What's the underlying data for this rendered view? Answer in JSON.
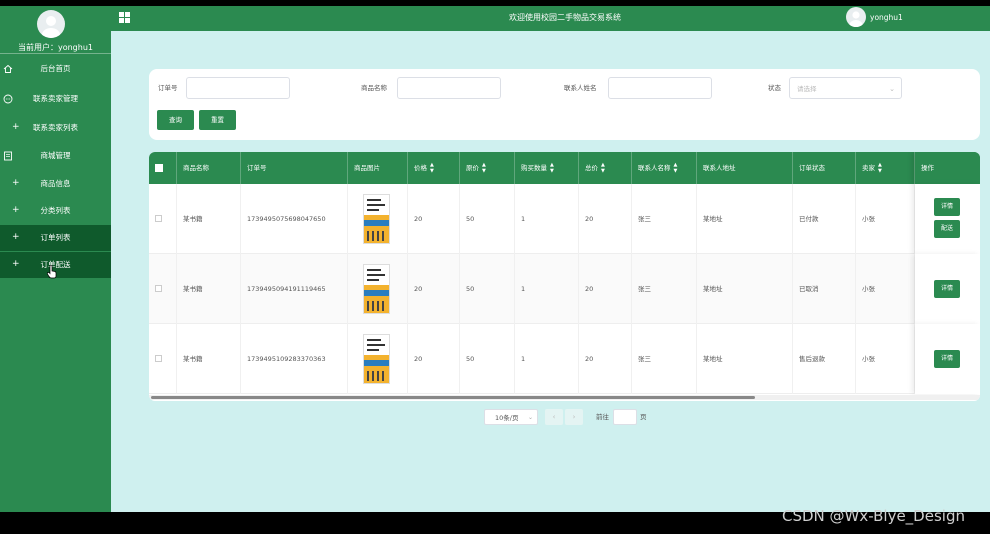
{
  "header": {
    "title": "欢迎使用校园二手物品交易系统",
    "username": "yonghu1"
  },
  "sidebar": {
    "current_user_label": "当前用户：",
    "current_user": "yonghu1",
    "items": [
      {
        "label": "后台首页",
        "icon": "home-icon"
      },
      {
        "label": "联系卖家管理",
        "icon": "chat-icon"
      },
      {
        "label": "联系卖家列表",
        "icon": "plus-icon"
      },
      {
        "label": "商城管理",
        "icon": "document-icon"
      },
      {
        "label": "商品信息",
        "icon": "plus-icon"
      },
      {
        "label": "分类列表",
        "icon": "plus-icon"
      },
      {
        "label": "订单列表",
        "icon": "plus-icon"
      },
      {
        "label": "订单配送",
        "icon": "plus-icon"
      }
    ]
  },
  "search": {
    "order_no_label": "订单号",
    "product_name_label": "商品名称",
    "contact_name_label": "联系人姓名",
    "status_label": "状态",
    "status_placeholder": "请选择",
    "query_button": "查询",
    "reset_button": "重置"
  },
  "table": {
    "columns": [
      "商品名称",
      "订单号",
      "商品图片",
      "价格",
      "原价",
      "购买数量",
      "总价",
      "联系人名称",
      "联系人地址",
      "订单状态",
      "卖家",
      "操作"
    ],
    "rows": [
      {
        "name": "某书籍",
        "order_no": "1739495075698047650",
        "price": "20",
        "original_price": "50",
        "qty": "1",
        "total": "20",
        "contact": "张三",
        "address": "某地址",
        "status": "已付款",
        "seller": "小张",
        "actions": [
          "详情",
          "配送"
        ]
      },
      {
        "name": "某书籍",
        "order_no": "1739495094191119465",
        "price": "20",
        "original_price": "50",
        "qty": "1",
        "total": "20",
        "contact": "张三",
        "address": "某地址",
        "status": "已取消",
        "seller": "小张",
        "actions": [
          "详情"
        ]
      },
      {
        "name": "某书籍",
        "order_no": "1739495109283370363",
        "price": "20",
        "original_price": "50",
        "qty": "1",
        "total": "20",
        "contact": "张三",
        "address": "某地址",
        "status": "售后退款",
        "seller": "小张",
        "actions": [
          "详情"
        ]
      }
    ]
  },
  "pagination": {
    "page_size": "10条/页",
    "prev": "‹",
    "next": "›",
    "goto_label": "前往",
    "page_unit": "页"
  },
  "watermark": "CSDN @Wx-Blye_Design",
  "colors": {
    "primary_green": "#2b8a50",
    "active_menu": "#0f5a2c",
    "main_bg": "#cff0ef"
  }
}
